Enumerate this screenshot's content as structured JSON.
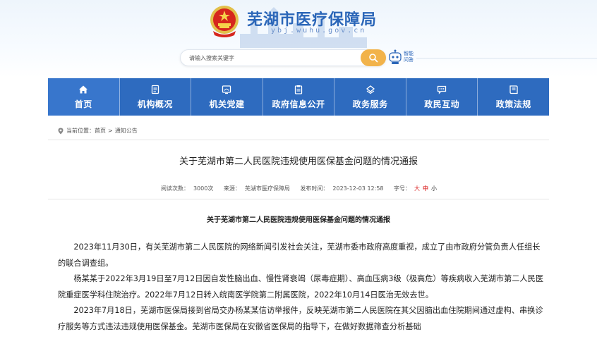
{
  "header": {
    "site_title": "芜湖市医疗保障局",
    "site_url": "ybj.wuhu.gov.cn",
    "search_placeholder": "请输入搜索关键字",
    "robot_label": "智能问答",
    "emblem_icon": "national-emblem-icon",
    "brand_color": "#2e6bbf",
    "search_button_color": "#f2b34a"
  },
  "nav": {
    "items": [
      {
        "label": "首页",
        "icon": "home-icon"
      },
      {
        "label": "机构概况",
        "icon": "document-icon"
      },
      {
        "label": "机关党建",
        "icon": "party-icon"
      },
      {
        "label": "政府信息公开",
        "icon": "clipboard-icon"
      },
      {
        "label": "政务服务",
        "icon": "service-icon"
      },
      {
        "label": "政民互动",
        "icon": "chat-icon"
      },
      {
        "label": "政策法规",
        "icon": "book-icon"
      }
    ]
  },
  "breadcrumb": {
    "prefix": "当前位置：",
    "home": "首页",
    "separator": ">",
    "current": "通知公告"
  },
  "article": {
    "title": "关于芜湖市第二人民医院违规使用医保基金问题的情况通报",
    "meta": {
      "views_label": "阅读次数：",
      "views": "3000次",
      "source_label": "来源：",
      "source": "芜湖市医疗保障局",
      "date_label": "发布时间：",
      "date": "2023-12-03 12:58",
      "fontsize_label": "字号：",
      "fs_large": "大",
      "fs_medium": "中",
      "fs_small": "小"
    },
    "body_title": "关于芜湖市第二人民医院违规使用医保基金问题的情况通报",
    "paragraphs": [
      "2023年11月30日，有关芜湖市第二人民医院的网络新闻引发社会关注，芜湖市委市政府高度重视，成立了由市政府分管负责人任组长的联合调查组。",
      "杨某某于2022年3月19日至7月12日因自发性脑出血、慢性肾衰竭（尿毒症期）、高血压病3级（极高危）等疾病收入芜湖市第二人民医院重症医学科住院治疗。2022年7月12日转入皖南医学院第二附属医院，2022年10月14日医治无效去世。",
      "2023年7月18日，芜湖市医保局接到省局交办杨某某信访举报件，反映芜湖市第二人民医院在其父因脑出血住院期间通过虚构、串换诊疗服务等方式违法违规使用医保基金。芜湖市医保局在安徽省医保局的指导下，在做好数据筛查分析基础"
    ]
  }
}
